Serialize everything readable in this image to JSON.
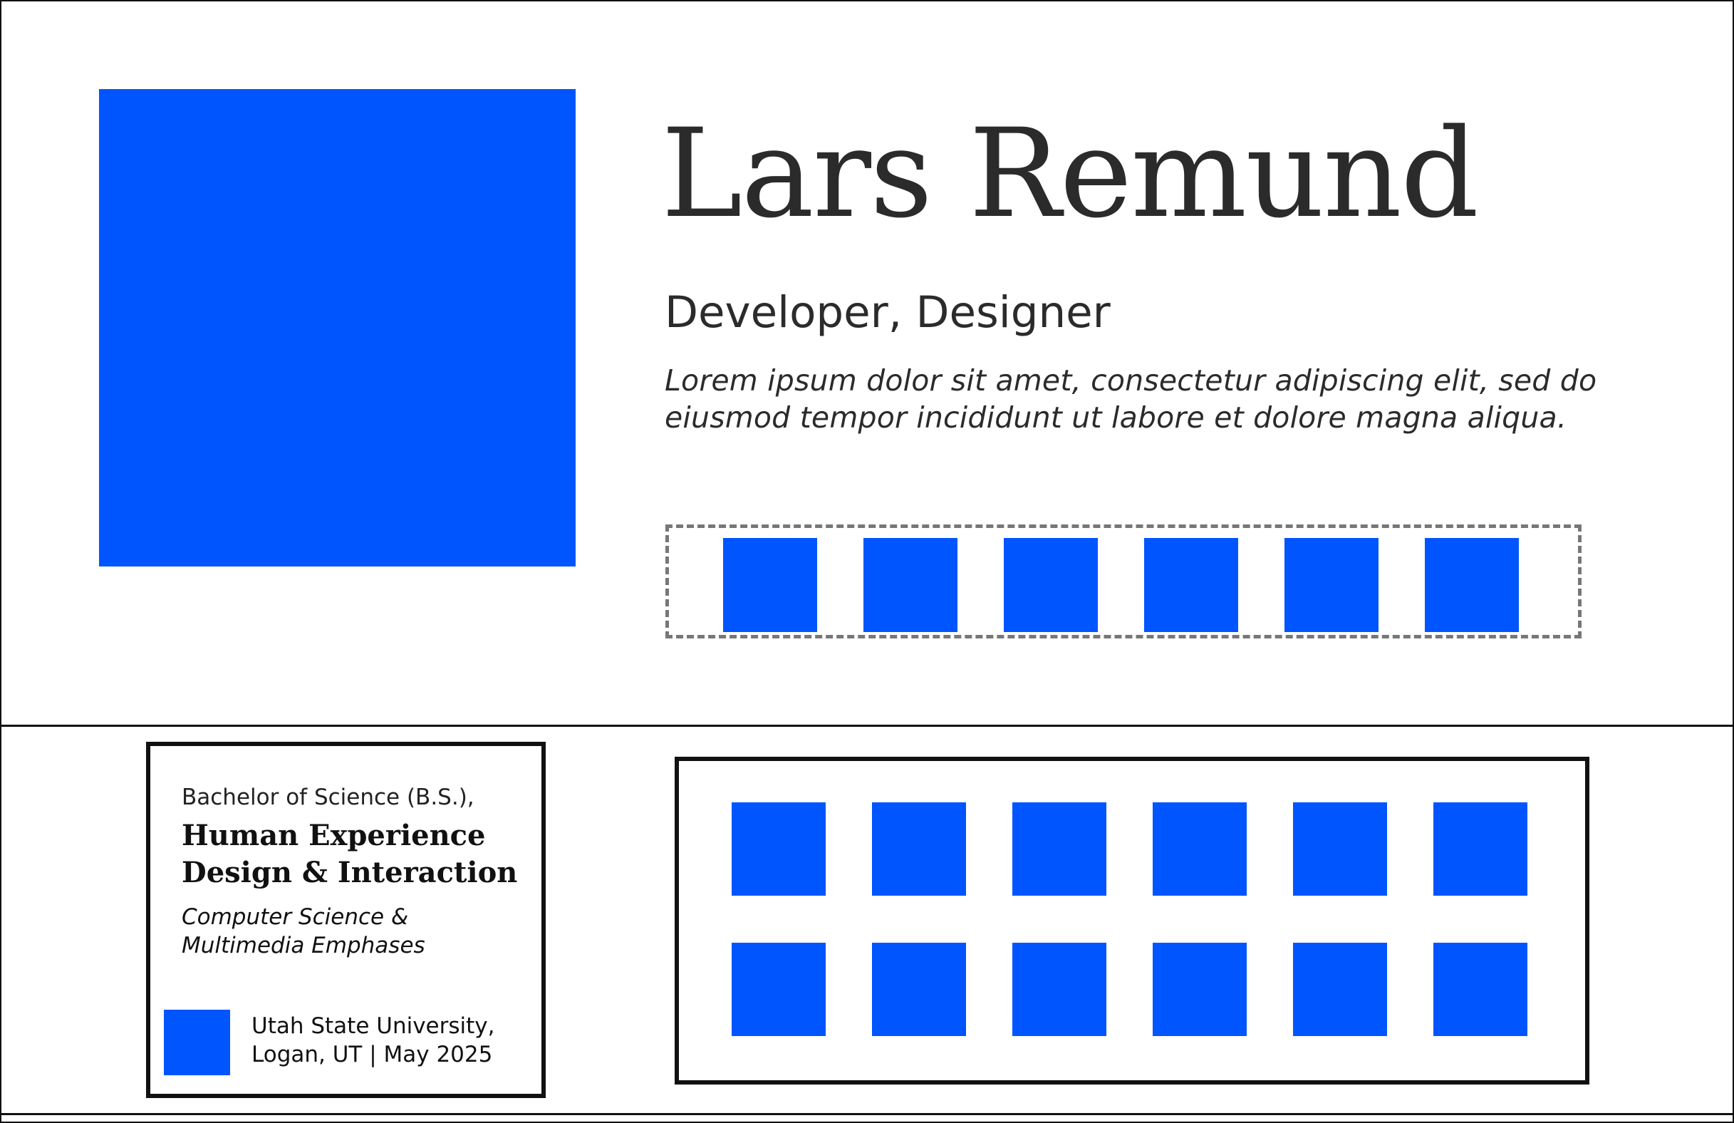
{
  "header": {
    "name": "Lars Remund",
    "role": "Developer, Designer",
    "bio": "Lorem ipsum dolor sit amet, consectetur adipiscing elit, sed do eiusmod tempor incididunt ut labore et dolore magna aliqua."
  },
  "education": {
    "degree": "Bachelor of Science (B.S.),",
    "major": "Human Experience Design & Interaction",
    "emphases": "Computer Science & Multimedia Emphases",
    "school_line1": "Utah State University,",
    "school_line2": "Logan, UT | May 2025"
  },
  "colors": {
    "accent": "#0055ff",
    "text": "#2b2b2b",
    "border": "#111111",
    "dashed_border": "#777777"
  }
}
